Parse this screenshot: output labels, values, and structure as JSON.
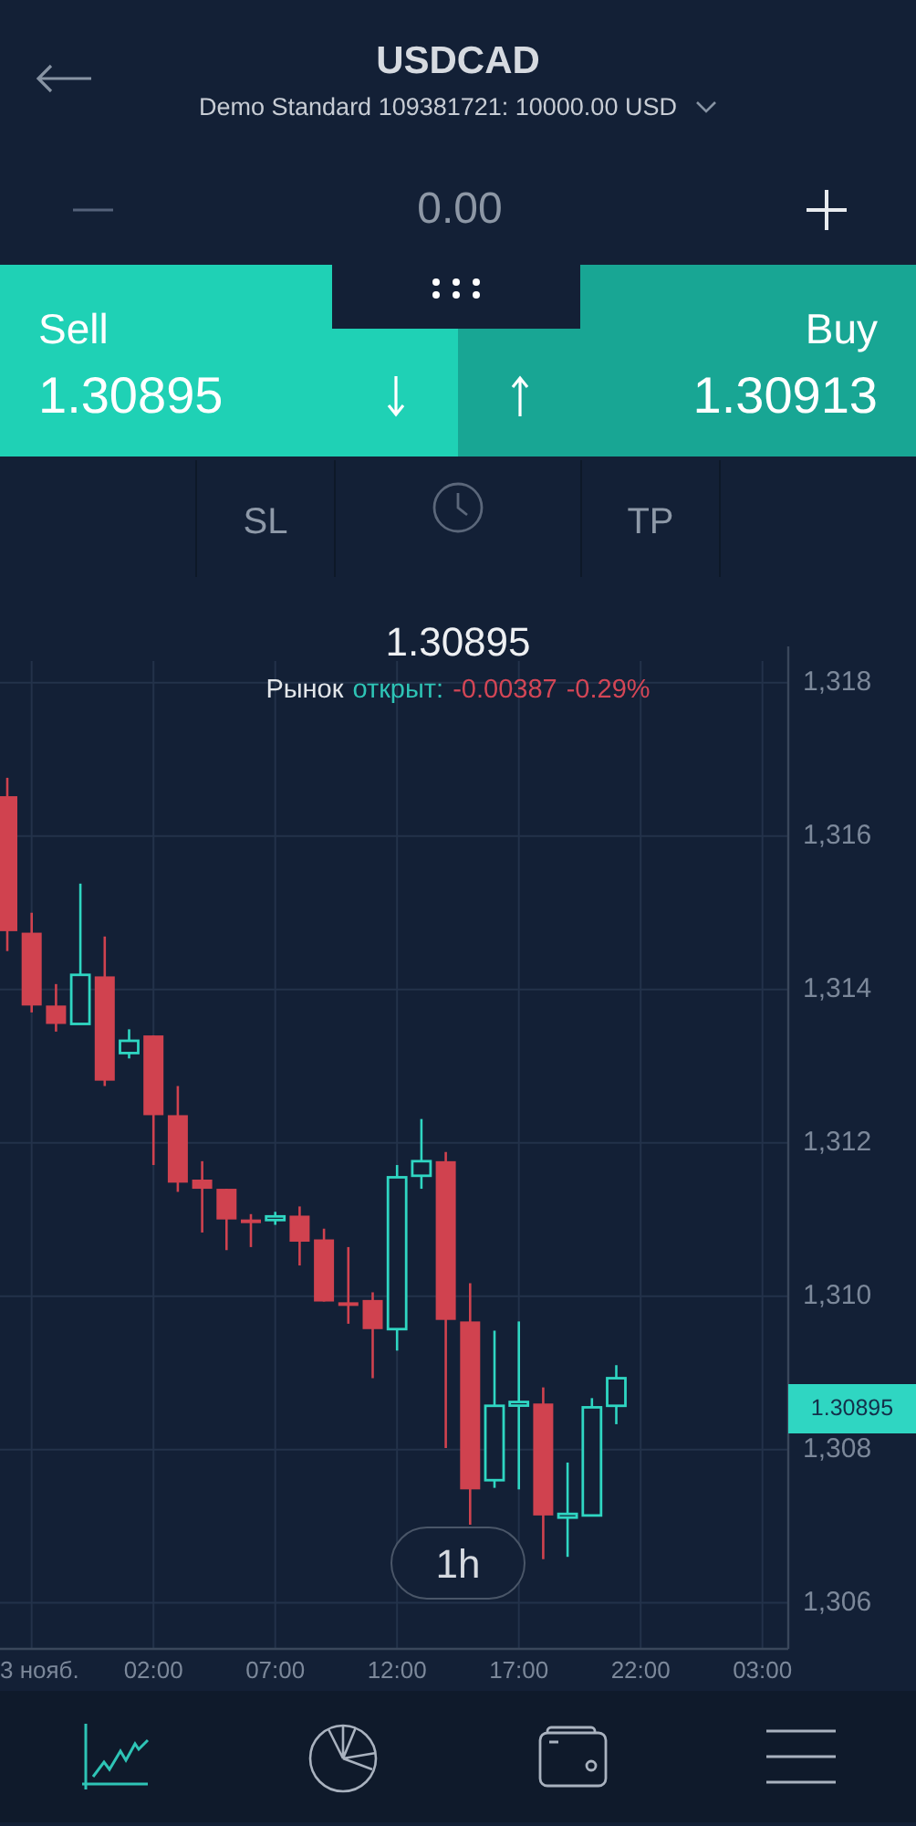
{
  "header": {
    "title": "USDCAD",
    "account": "Demo Standard 109381721: 10000.00 USD"
  },
  "volume": {
    "value": "0.00"
  },
  "trade": [
    {
      "kind": "sell",
      "label": "Sell",
      "price": "1.30895"
    },
    {
      "kind": "buy",
      "label": "Buy",
      "price": "1.30913"
    }
  ],
  "order_options": [
    {
      "kind": "text",
      "label": "SL"
    },
    {
      "kind": "clock"
    },
    {
      "kind": "text",
      "label": "TP"
    }
  ],
  "chart": {
    "price": "1.30895",
    "market": {
      "label": "Рынок",
      "state": "открыт:",
      "change": "-0.00387",
      "change_percent": "-0.29%"
    },
    "price_tag": "1.30895",
    "timeframe": "1h",
    "x_axis_labels": [
      "3 нояб.",
      "02:00",
      "07:00",
      "12:00",
      "17:00",
      "22:00",
      "03:00"
    ],
    "y_axis_labels": [
      "1,318",
      "1,316",
      "1,314",
      "1,312",
      "1,310",
      "1,308",
      "1,306"
    ]
  },
  "nav": [
    {
      "kind": "chart",
      "selected": true
    },
    {
      "kind": "pie",
      "selected": false
    },
    {
      "kind": "wallet",
      "selected": false
    },
    {
      "kind": "menu",
      "selected": false
    }
  ]
}
